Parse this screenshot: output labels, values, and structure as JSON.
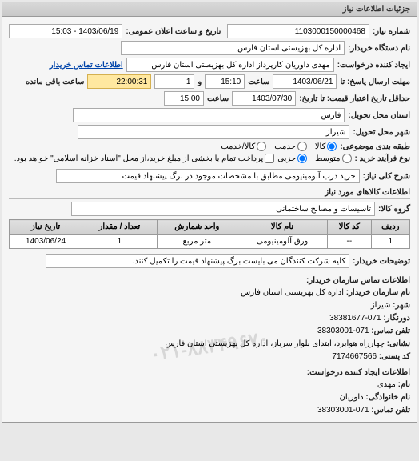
{
  "panel": {
    "title": "جزئیات اطلاعات نیاز"
  },
  "fields": {
    "need_number_label": "شماره نیاز:",
    "need_number": "1103000150000468",
    "announce_datetime_label": "تاریخ و ساعت اعلان عمومی:",
    "announce_datetime": "1403/06/19 - 15:03",
    "buyer_org_label": "نام دستگاه خریدار:",
    "buyer_org": "اداره کل بهزیستی استان فارس",
    "requester_label": "ایجاد کننده درخواست:",
    "requester": "مهدی داوریان کارپرداز اداره کل بهزیستی استان فارس",
    "buyer_contact_link": "اطلاعات تماس خریدار",
    "reply_deadline_label": "مهلت ارسال پاسخ: تا",
    "reply_date": "1403/06/21",
    "time_label": "ساعت",
    "reply_time": "15:10",
    "day_label": "و",
    "reply_days": "1",
    "remaining_time": "22:00:31",
    "remaining_label": "ساعت باقی مانده",
    "validity_label": "حداقل تاریخ اعتبار قیمت: تا تاریخ:",
    "validity_date": "1403/07/30",
    "validity_time": "15:00",
    "delivery_province_label": "استان محل تحویل:",
    "delivery_province": "فارس",
    "delivery_city_label": "شهر محل تحویل:",
    "delivery_city": "شیراز",
    "class_label": "طبقه بندی موضوعی:",
    "class_goods": "کالا",
    "class_service": "خدمت",
    "class_goods_service": "کالا/خدمت",
    "buy_type_label": "نوع فرآیند خرید :",
    "buy_type_normal": "متوسط",
    "buy_type_partial": "جزیی",
    "partial_pay_label": "پرداخت تمام یا بخشی از مبلغ خرید،از محل \"اسناد خزانه اسلامی\" خواهد بود.",
    "overall_desc_label": "شرح کلی نیاز:",
    "overall_desc": "خرید درب آلومینیومی مطابق با مشخصات موجود در برگ پیشنهاد قیمت",
    "items_section_title": "اطلاعات کالاهای مورد نیاز",
    "goods_group_label": "گروه کالا:",
    "goods_group": "تاسیسات و مصالح ساختمانی",
    "buyer_notes_label": "توضیحات خریدار:",
    "buyer_notes": "کلیه شرکت کنندگان می بایست برگ پیشنهاد قیمت را تکمیل کنند.",
    "contact_section_title": "اطلاعات تماس سازمان خریدار:",
    "org_name_label": "نام سازمان خریدار:",
    "org_name": "اداره کل بهزیستی استان فارس",
    "city_label": "شهر:",
    "city": "شیراز",
    "fax_label": "دورنگار:",
    "fax": "071-38381677",
    "phone_label": "تلفن تماس:",
    "phone": "071-38303001",
    "address_label": "نشانی:",
    "address": "چهارراه هوابرد، ابتدای بلوار سرباز، اداره کل بهزیستی استان فارس",
    "postal_label": "کد پستی:",
    "postal": "7174667566",
    "creator_section_title": "اطلاعات ایجاد کننده درخواست:",
    "creator_name_label": "نام:",
    "creator_name": "مهدی",
    "creator_family_label": "نام خانوادگی:",
    "creator_family": "داوریان",
    "creator_phone_label": "تلفن تماس:",
    "creator_phone": "071-38303001"
  },
  "table": {
    "headers": {
      "row": "ردیف",
      "code": "کد کالا",
      "name": "نام کالا",
      "unit": "واحد شمارش",
      "qty": "تعداد / مقدار",
      "date": "تاریخ نیاز"
    },
    "rows": [
      {
        "row": "1",
        "code": "--",
        "name": "ورق آلومینیومی",
        "unit": "متر مربع",
        "qty": "1",
        "date": "1403/06/24"
      }
    ]
  },
  "watermark": "۰۲۱-۸۸۳۴۹۶۷۰"
}
